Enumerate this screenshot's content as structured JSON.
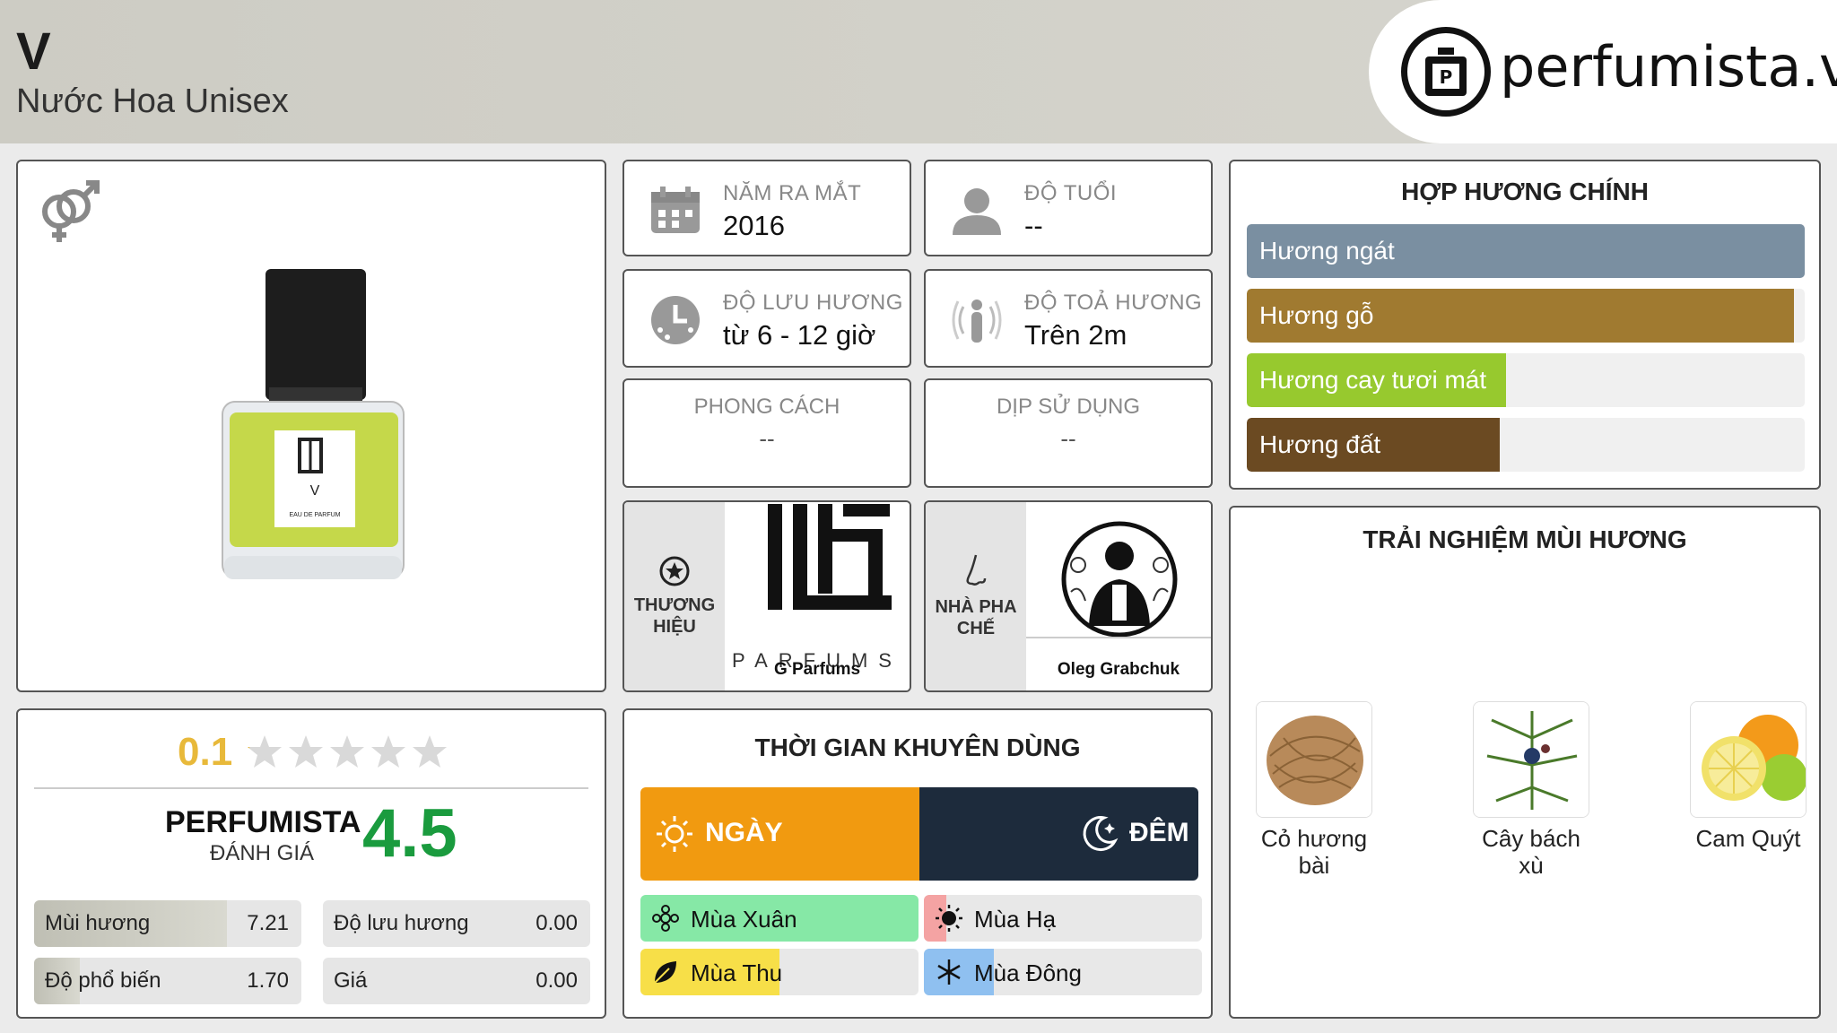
{
  "header": {
    "title": "V",
    "subtitle": "Nước Hoa Unisex",
    "logo_text": "perfumista.vn"
  },
  "product": {
    "gender_icon": "unisex-icon",
    "bottle_label": "V",
    "bottle_sublabel": "EAU DE PARFUM"
  },
  "info": {
    "launch": {
      "label": "NĂM RA MẮT",
      "value": "2016",
      "icon": "calendar-icon"
    },
    "age": {
      "label": "ĐỘ TUỔI",
      "value": "--",
      "icon": "person-icon"
    },
    "longevity": {
      "label": "ĐỘ LƯU HƯƠNG",
      "value": "từ 6 - 12 giờ",
      "icon": "clock-icon"
    },
    "sillage": {
      "label": "ĐỘ TOẢ HƯƠNG",
      "value": "Trên 2m",
      "icon": "sillage-icon"
    },
    "style": {
      "label": "PHONG CÁCH",
      "value": "--"
    },
    "occasion": {
      "label": "DỊP SỬ DỤNG",
      "value": "--"
    }
  },
  "brand": {
    "label_line1": "THƯƠNG",
    "label_line2": "HIỆU",
    "logo_word": "PARFUMS",
    "name": "G Parfums",
    "icon": "star-circle-icon"
  },
  "perfumer": {
    "label_line1": "NHÀ PHA",
    "label_line2": "CHẾ",
    "name": "Oleg Grabchuk",
    "icon": "nose-icon"
  },
  "accords": {
    "title": "HỢP HƯƠNG CHÍNH",
    "items": [
      {
        "label": "Hương ngát",
        "level": 1.0,
        "color": "#7a8fa1"
      },
      {
        "label": "Hương gỗ",
        "level": 0.98,
        "color": "#a07a30"
      },
      {
        "label": "Hương cay tươi mát",
        "level": 0.465,
        "color": "#97c92e"
      },
      {
        "label": "Hương đất",
        "level": 0.453,
        "color": "#6b4a22"
      }
    ]
  },
  "rating": {
    "score": "0.1",
    "stars_filled": 0.02,
    "perfumista_label": "PERFUMISTA",
    "perfumista_sub": "ĐÁNH GIÁ",
    "perfumista_score": "4.5",
    "metrics": [
      {
        "label": "Mùi hương",
        "value": "7.21",
        "level": 0.721
      },
      {
        "label": "Độ lưu hương",
        "value": "0.00",
        "level": 0.0
      },
      {
        "label": "Độ phổ biến",
        "value": "1.70",
        "level": 0.17
      },
      {
        "label": "Giá",
        "value": "0.00",
        "level": 0.0
      }
    ]
  },
  "time": {
    "title": "THỜI GIAN KHUYÊN DÙNG",
    "day_label": "NGÀY",
    "night_label": "ĐÊM",
    "day_level": 0.5,
    "seasons": [
      {
        "label": "Mùa Xuân",
        "level": 1.0,
        "color": "#86e8a6",
        "icon": "flower-icon"
      },
      {
        "label": "Mùa Hạ",
        "level": 0.08,
        "color": "#f4a3a3",
        "icon": "sun-icon"
      },
      {
        "label": "Mùa Thu",
        "level": 0.5,
        "color": "#f7df48",
        "icon": "leaf-icon"
      },
      {
        "label": "Mùa Đông",
        "level": 0.25,
        "color": "#8fc0f0",
        "icon": "snowflake-icon"
      }
    ]
  },
  "notes": {
    "title": "TRẢI NGHIỆM MÙI HƯƠNG",
    "items": [
      {
        "label": "Cỏ hương bài"
      },
      {
        "label": "Cây bách xù"
      },
      {
        "label": "Cam Quýt"
      }
    ]
  },
  "colors": {
    "gold": "#e8b93a",
    "green_score": "#1a9b3e",
    "day": "#f19a10",
    "night": "#1d2b3c"
  }
}
